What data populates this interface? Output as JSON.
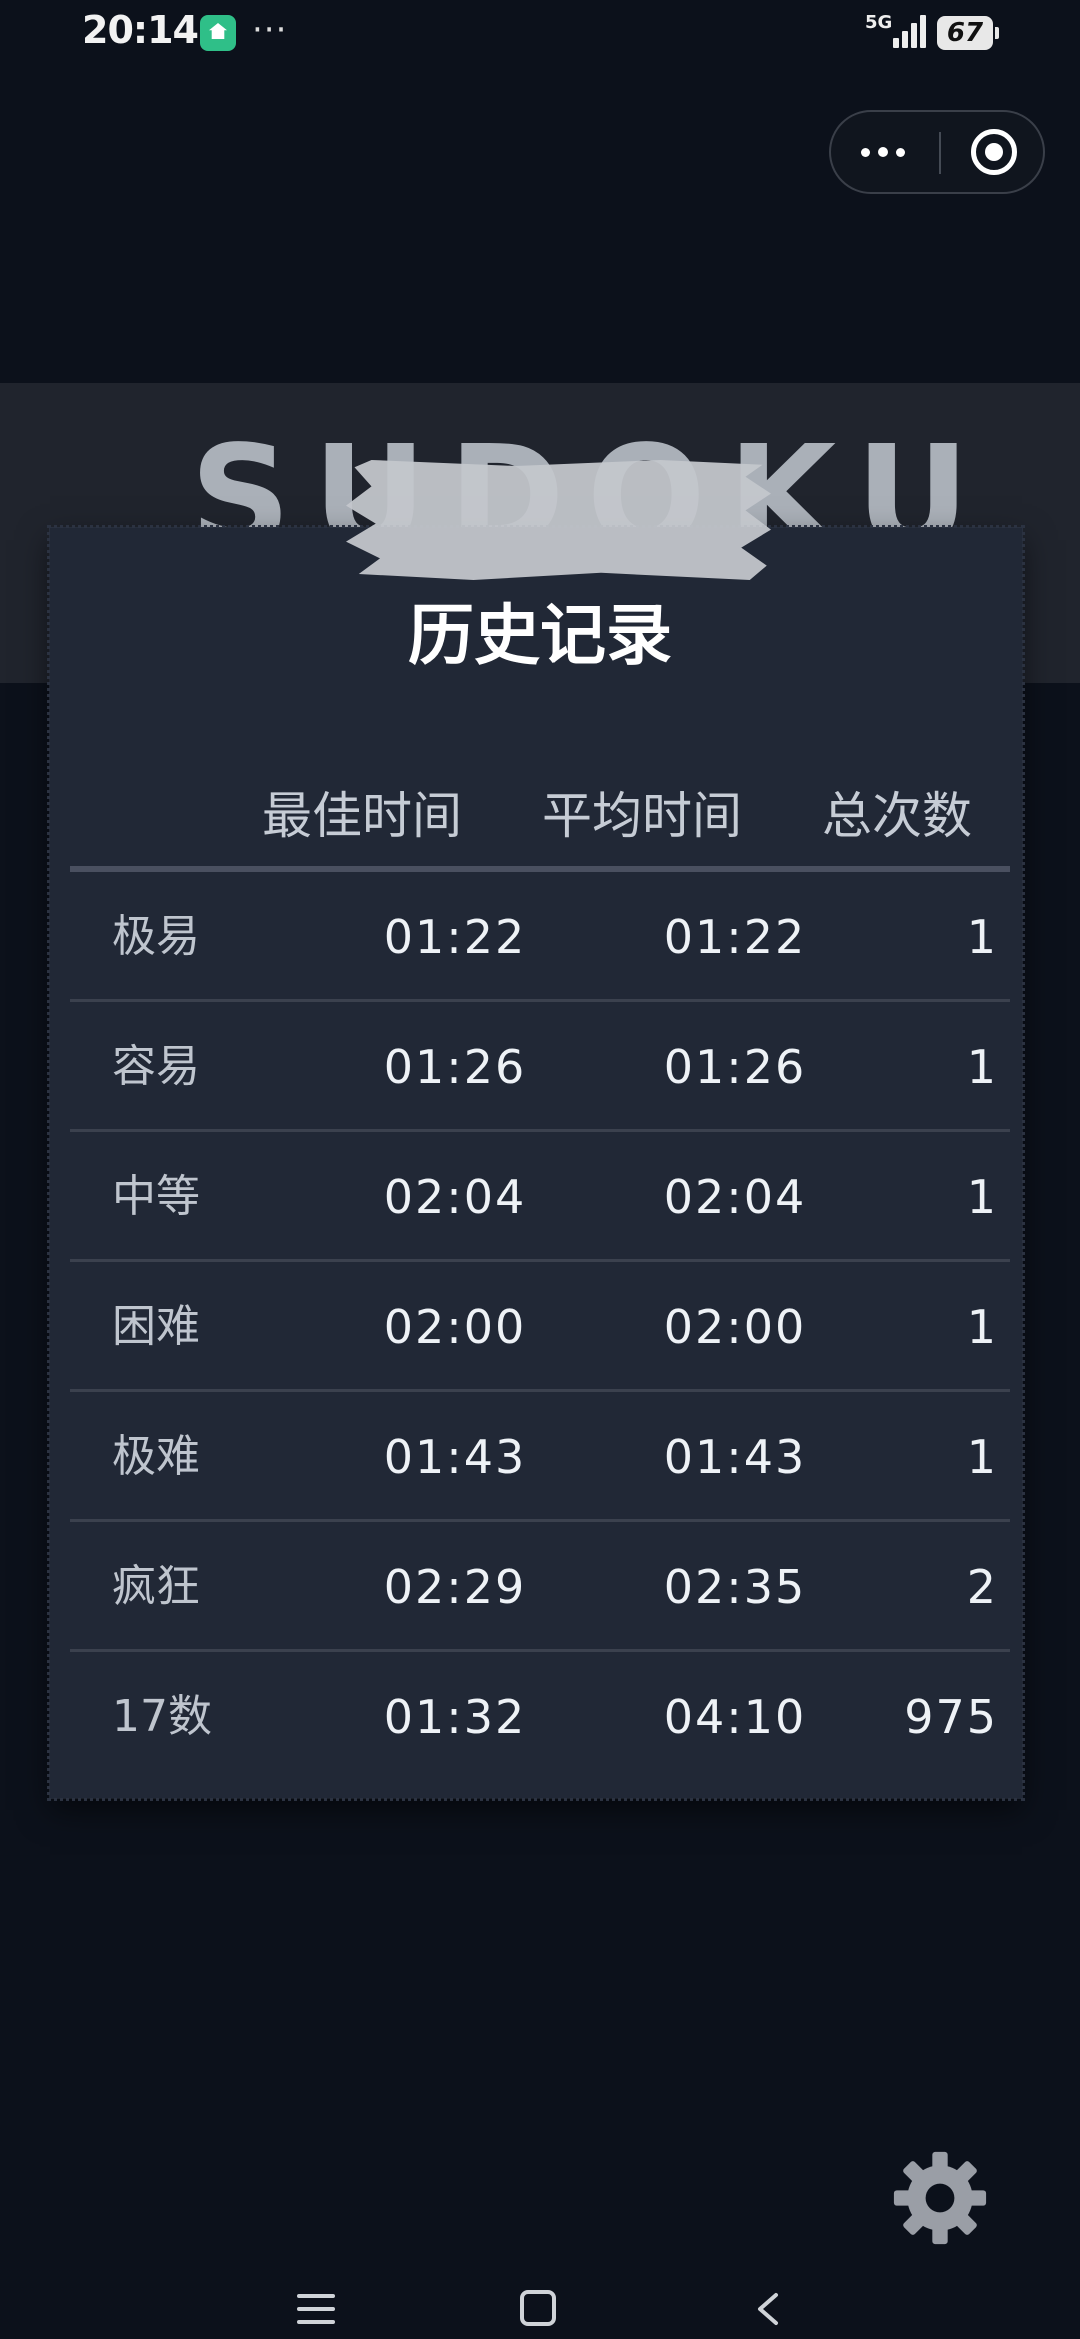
{
  "status_bar": {
    "time": "20:14",
    "app_icon": "home-app-icon",
    "more": "···",
    "network": "5G",
    "battery": "67"
  },
  "capsule": {
    "menu_icon": "more-dots-icon",
    "close_icon": "target-circle-icon"
  },
  "background": {
    "logo_text": "SUDOKU"
  },
  "history": {
    "title": "历史记录",
    "headers": {
      "best": "最佳时间",
      "average": "平均时间",
      "count": "总次数"
    },
    "rows": [
      {
        "level": "极易",
        "best": "01:22",
        "average": "01:22",
        "count": "1"
      },
      {
        "level": "容易",
        "best": "01:26",
        "average": "01:26",
        "count": "1"
      },
      {
        "level": "中等",
        "best": "02:04",
        "average": "02:04",
        "count": "1"
      },
      {
        "level": "困难",
        "best": "02:00",
        "average": "02:00",
        "count": "1"
      },
      {
        "level": "极难",
        "best": "01:43",
        "average": "01:43",
        "count": "1"
      },
      {
        "level": "疯狂",
        "best": "02:29",
        "average": "02:35",
        "count": "2"
      },
      {
        "level": "17数",
        "best": "01:32",
        "average": "04:10",
        "count": "975"
      }
    ]
  },
  "settings": {
    "icon": "gear-icon"
  },
  "nav_bar": {
    "menu_icon": "menu-icon",
    "home_icon": "home-square-icon",
    "back_icon": "back-chevron-icon"
  },
  "colors": {
    "background": "#0c111b",
    "panel": "#212836",
    "text": "#eef2f6"
  }
}
